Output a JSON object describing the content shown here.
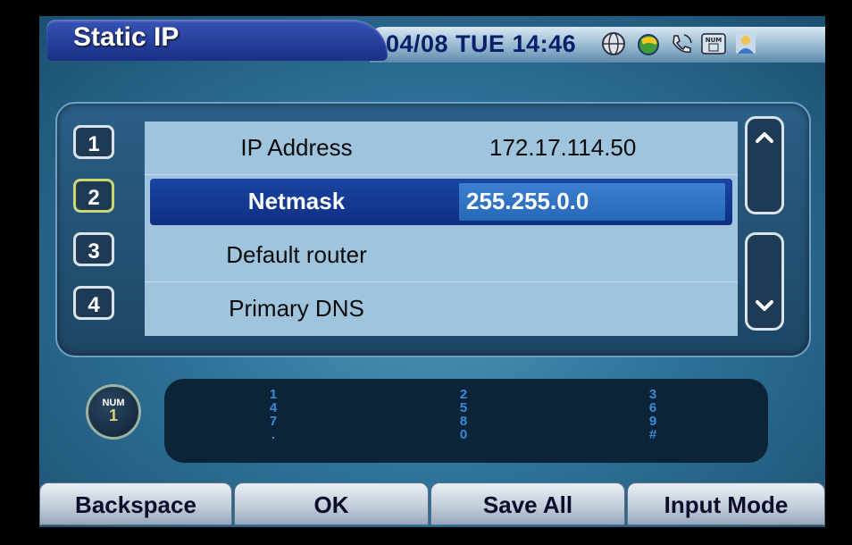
{
  "header": {
    "title": "Static IP",
    "datetime": "04/08 TUE 14:46",
    "status_icons": [
      "globe-icon",
      "network-icon",
      "phone-icon",
      "num-keyboard-icon",
      "user-icon"
    ]
  },
  "list": {
    "rows": [
      {
        "index": "1",
        "label": "IP Address",
        "value": "172.17.114.50"
      },
      {
        "index": "2",
        "label": "Netmask",
        "value": "255.255.0.0"
      },
      {
        "index": "3",
        "label": "Default router",
        "value": ""
      },
      {
        "index": "4",
        "label": "Primary DNS",
        "value": ""
      }
    ],
    "selected_index": 2
  },
  "input_mode": {
    "badge_top": "NUM",
    "badge_bottom": "1"
  },
  "keypad": {
    "col1": [
      "1",
      "4",
      "7",
      "."
    ],
    "col2": [
      "2",
      "5",
      "8",
      "0"
    ],
    "col3": [
      "3",
      "6",
      "9",
      "#"
    ]
  },
  "softkeys": {
    "backspace": "Backspace",
    "ok": "OK",
    "save_all": "Save All",
    "input_mode": "Input Mode"
  },
  "colors": {
    "selected_row": "#0d2f82",
    "value_highlight": "#2f74c4",
    "background": "#2f7399"
  }
}
